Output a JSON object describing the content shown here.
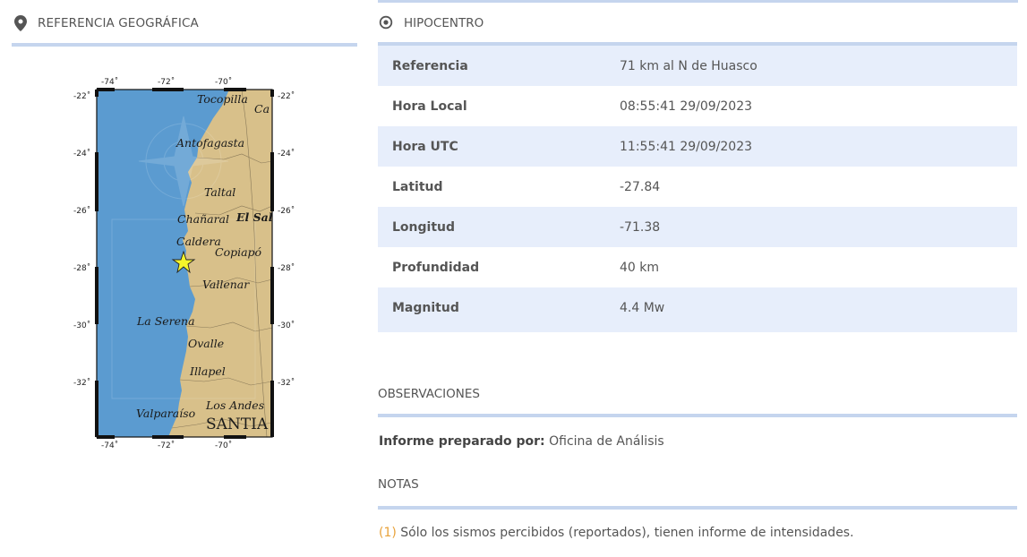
{
  "left_panel": {
    "title": "REFERENCIA GEOGRÁFICA",
    "icon": "map-marker-icon",
    "map": {
      "lon_ticks_top": [
        "-74˚",
        "-72˚",
        "-70˚"
      ],
      "lon_ticks_bottom": [
        "-74˚",
        "-72˚",
        "-70˚"
      ],
      "lat_ticks_left": [
        "-22˚",
        "-24˚",
        "-26˚",
        "-28˚",
        "-30˚",
        "-32˚"
      ],
      "lat_ticks_right": [
        "-22˚",
        "-24˚",
        "-26˚",
        "-28˚",
        "-30˚",
        "-32˚"
      ],
      "cities": {
        "tocopilla": "Tocopilla",
        "calama": "Ca",
        "antofagasta": "Antofagasta",
        "taltal": "Taltal",
        "chanaral": "Chañaral",
        "el_salvador": "El Sal",
        "caldera": "Caldera",
        "copiapo": "Copiapó",
        "vallenar": "Vallenar",
        "la_serena": "La Serena",
        "ovalle": "Ovalle",
        "illapel": "Illapel",
        "los_andes": "Los Andes",
        "valparaiso": "Valparaíso",
        "santiago": "SANTIA"
      },
      "epicenter_marker": "star-icon",
      "colors": {
        "ocean": "#5b9bd0",
        "land": "#d8c08a",
        "marker": "#f5f52a"
      }
    }
  },
  "right_panel": {
    "title": "HIPOCENTRO",
    "icon": "target-icon",
    "rows": [
      {
        "label": "Referencia",
        "value": "71 km al N de Huasco"
      },
      {
        "label": "Hora Local",
        "value": "08:55:41 29/09/2023"
      },
      {
        "label": "Hora UTC",
        "value": "11:55:41 29/09/2023"
      },
      {
        "label": "Latitud",
        "value": "-27.84"
      },
      {
        "label": "Longitud",
        "value": "-71.38"
      },
      {
        "label": "Profundidad",
        "value": "40 km"
      },
      {
        "label": "Magnitud",
        "value": "4.4 Mw"
      }
    ],
    "observaciones": {
      "title": "OBSERVACIONES",
      "prepared_by_label": "Informe preparado por:",
      "prepared_by_value": "Oficina de Análisis"
    },
    "notas": {
      "title": "NOTAS",
      "number": "(1)",
      "text": "Sólo los sismos percibidos (reportados), tienen informe de intensidades."
    }
  },
  "colors": {
    "accent_rule": "#c5d5ee",
    "row_stripe": "#e7eefb",
    "note_number": "#e8a23a"
  }
}
